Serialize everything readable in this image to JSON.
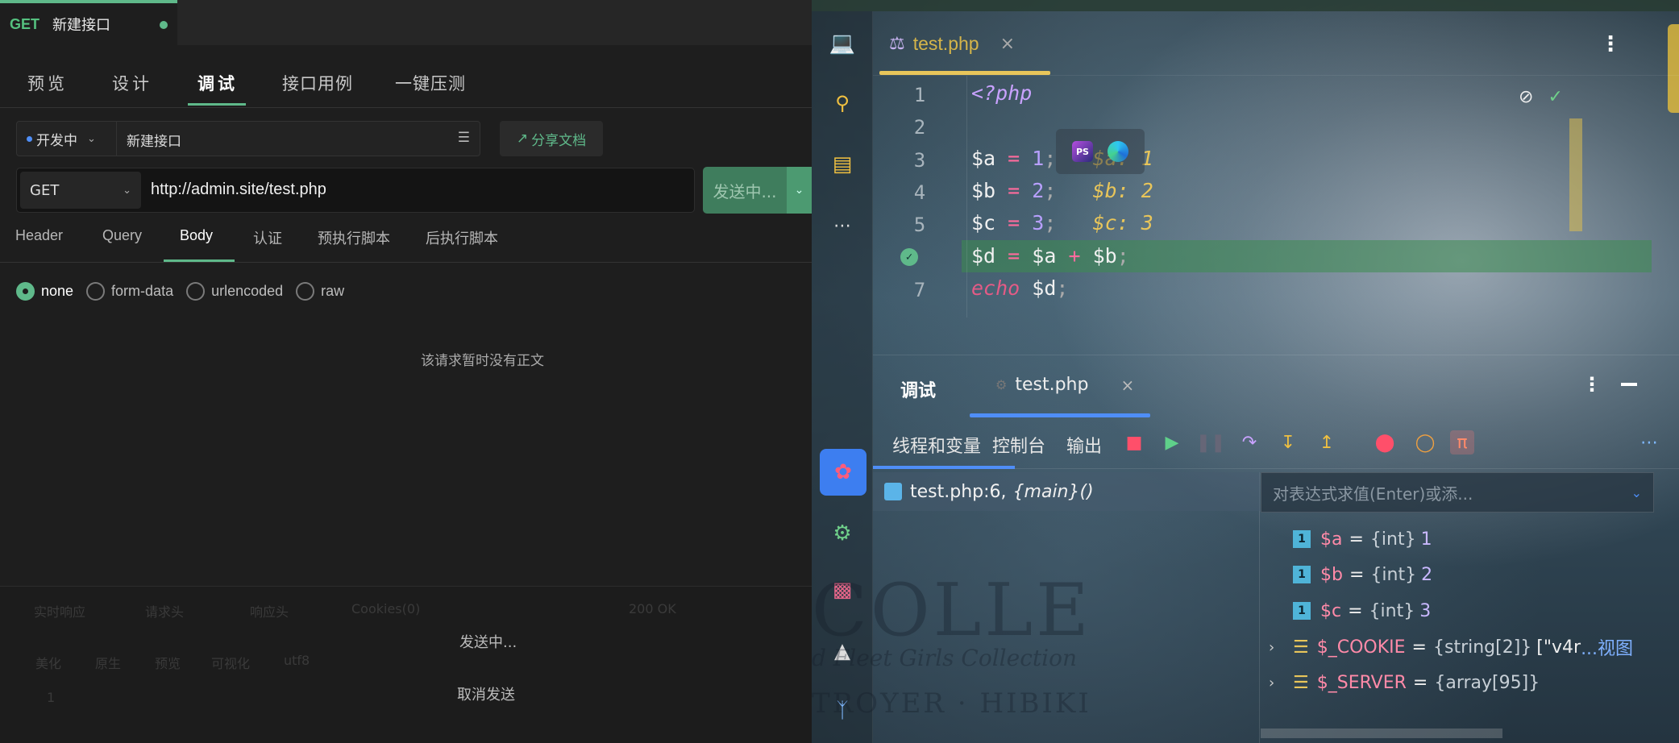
{
  "api_tool": {
    "doc_tab": {
      "method": "GET",
      "title": "新建接口"
    },
    "view_tabs": [
      "预览",
      "设计",
      "调试",
      "接口用例",
      "一键压测"
    ],
    "active_view_tab": "调试",
    "status": "开发中",
    "api_name": "新建接口",
    "share_label": "分享文档",
    "method": "GET",
    "url": "http://admin.site/test.php",
    "send_label": "发送中...",
    "request_tabs": [
      "Header",
      "Query",
      "Body",
      "认证",
      "预执行脚本",
      "后执行脚本"
    ],
    "active_request_tab": "Body",
    "body_types": [
      "none",
      "form-data",
      "urlencoded",
      "raw"
    ],
    "selected_body_type": "none",
    "empty_body_text": "该请求暂时没有正文",
    "response": {
      "tabs": [
        "实时响应",
        "请求头",
        "响应头",
        "Cookies(0)"
      ],
      "subtabs": [
        "美化",
        "原生",
        "预览",
        "可视化",
        "utf8"
      ],
      "summary": "200 OK",
      "line_no": "1"
    },
    "overlay": {
      "sending": "发送中...",
      "cancel": "取消发送"
    }
  },
  "ide": {
    "file_tab": "test.php",
    "code_lines": [
      {
        "num": "1"
      },
      {
        "num": "2"
      },
      {
        "num": "3",
        "inline": "$a: 1"
      },
      {
        "num": "4",
        "inline": "$b: 2"
      },
      {
        "num": "5",
        "inline": "$c: 3"
      },
      {
        "num": "6"
      },
      {
        "num": "7"
      }
    ],
    "code": {
      "l1": "<?php",
      "l7_kw": "echo"
    },
    "debug_panel": {
      "title": "调试",
      "session_tab": "test.php",
      "tabs": [
        "线程和变量",
        "控制台",
        "输出"
      ],
      "frame": {
        "file": "test.php:6,",
        "fn": "{main}()"
      },
      "eval_placeholder": "对表达式求值(Enter)或添...",
      "variables": [
        {
          "name": "$a",
          "type": "{int}",
          "value": "1"
        },
        {
          "name": "$b",
          "type": "{int}",
          "value": "2"
        },
        {
          "name": "$c",
          "type": "{int}",
          "value": "3"
        },
        {
          "name": "$_COOKIE",
          "type": "{string[2]}",
          "value": "[\"v4r",
          "link": "...视图"
        },
        {
          "name": "$_SERVER",
          "type": "{array[95]}",
          "value": ""
        }
      ]
    },
    "watermark": {
      "line1": "COLLE",
      "line2": "d Fleet Girls Collection",
      "line3": "TROYER · HIBIKI"
    }
  },
  "colors": {
    "accent_green": "#5fb98a",
    "ide_blue": "#4f8ef7",
    "tab_gold": "#e8c55a"
  }
}
